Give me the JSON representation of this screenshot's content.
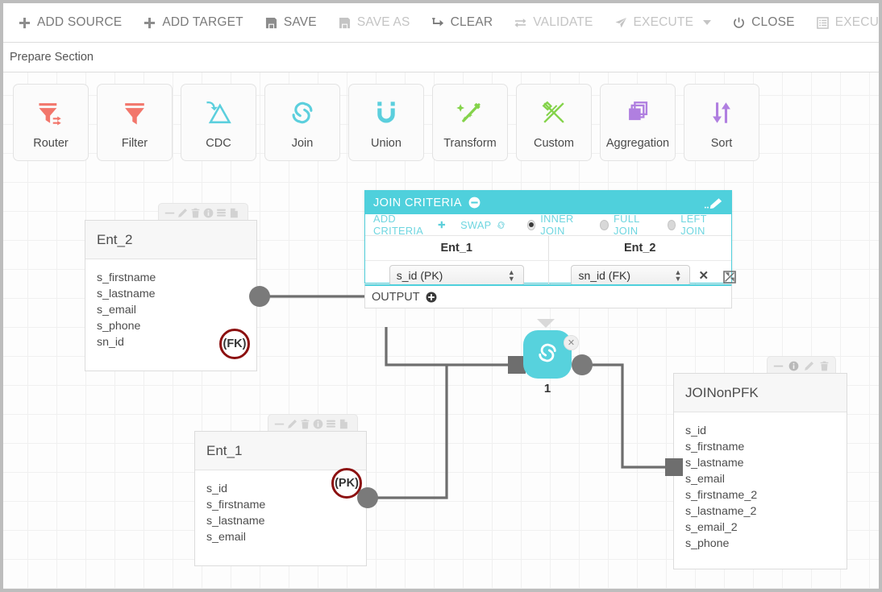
{
  "toolbar": {
    "items": [
      {
        "label": "ADD SOURCE",
        "icon": "plus-icon",
        "state": "enabled"
      },
      {
        "label": "ADD TARGET",
        "icon": "plus-icon",
        "state": "enabled"
      },
      {
        "label": "SAVE",
        "icon": "save-icon",
        "state": "enabled"
      },
      {
        "label": "SAVE AS",
        "icon": "save-icon",
        "state": "disabled"
      },
      {
        "label": "CLEAR",
        "icon": "clear-icon",
        "state": "enabled"
      },
      {
        "label": "VALIDATE",
        "icon": "validate-icon",
        "state": "disabled"
      },
      {
        "label": "EXECUTE",
        "icon": "execute-icon",
        "state": "disabled",
        "caret": true
      },
      {
        "label": "CLOSE",
        "icon": "power-icon",
        "state": "enabled"
      },
      {
        "label": "EXECUTION LOGS",
        "icon": "logs-icon",
        "state": "disabled"
      }
    ]
  },
  "section_bar": {
    "title": "Prepare Section"
  },
  "palette": {
    "items": [
      {
        "label": "Router",
        "icon": "router-icon",
        "color": "#f2766b"
      },
      {
        "label": "Filter",
        "icon": "filter-icon",
        "color": "#f2766b"
      },
      {
        "label": "CDC",
        "icon": "cdc-icon",
        "color": "#5bcfdd"
      },
      {
        "label": "Join",
        "icon": "join-link-icon",
        "color": "#5bcfdd"
      },
      {
        "label": "Union",
        "icon": "union-magnet-icon",
        "color": "#5bcfdd"
      },
      {
        "label": "Transform",
        "icon": "magic-wand-icon",
        "color": "#84d34a"
      },
      {
        "label": "Custom",
        "icon": "custom-tools-icon",
        "color": "#84d34a"
      },
      {
        "label": "Aggregation",
        "icon": "layers-icon",
        "color": "#b07fe0"
      },
      {
        "label": "Sort",
        "icon": "sort-arrows-icon",
        "color": "#b07fe0"
      }
    ]
  },
  "join_panel": {
    "title": "JOIN CRITERIA",
    "collapse_icon": "minus-circle-icon",
    "edit_icon": "pencil-icon",
    "add_criteria_label": "ADD CRITERIA",
    "add_criteria_icon": "plus-icon",
    "swap_label": "SWAP",
    "swap_icon": "link-icon",
    "join_types": [
      {
        "label": "INNER JOIN",
        "selected": true
      },
      {
        "label": "FULL JOIN",
        "selected": false
      },
      {
        "label": "LEFT JOIN",
        "selected": false
      }
    ],
    "columns": [
      "Ent_1",
      "Ent_2"
    ],
    "criteria_rows": [
      {
        "left_value": "s_id (PK)",
        "right_value": "sn_id (FK)",
        "remove_icon": "close-icon"
      }
    ],
    "output_label": "OUTPUT",
    "output_add_icon": "plus-circle-icon",
    "resize_icon": "resize-handle-icon",
    "accent_color": "#4fd0dc"
  },
  "entities": {
    "ent_2": {
      "name": "Ent_2",
      "fields": [
        "s_firstname",
        "s_lastname",
        "s_email",
        "s_phone",
        "sn_id"
      ],
      "key_badge": "(FK)",
      "key_color": "#8c1010",
      "tools": [
        "minus-icon",
        "pencil-icon",
        "trash-icon",
        "info-icon",
        "database-icon",
        "file-icon"
      ]
    },
    "ent_1": {
      "name": "Ent_1",
      "fields": [
        "s_id",
        "s_firstname",
        "s_lastname",
        "s_email"
      ],
      "key_badge": "(PK)",
      "key_color": "#8c1010",
      "tools": [
        "minus-icon",
        "pencil-icon",
        "trash-icon",
        "info-icon",
        "database-icon",
        "file-icon"
      ]
    },
    "join_output": {
      "name": "JOINonPFK",
      "fields": [
        "s_id",
        "s_firstname",
        "s_lastname",
        "s_email",
        "s_firstname_2",
        "s_lastname_2",
        "s_email_2",
        "s_phone"
      ],
      "tools": [
        "minus-icon",
        "info-icon",
        "pencil-icon",
        "trash-icon"
      ]
    }
  },
  "join_node": {
    "label": "1",
    "icon": "join-link-icon",
    "close_icon": "close-icon",
    "color": "#57d2dd"
  }
}
